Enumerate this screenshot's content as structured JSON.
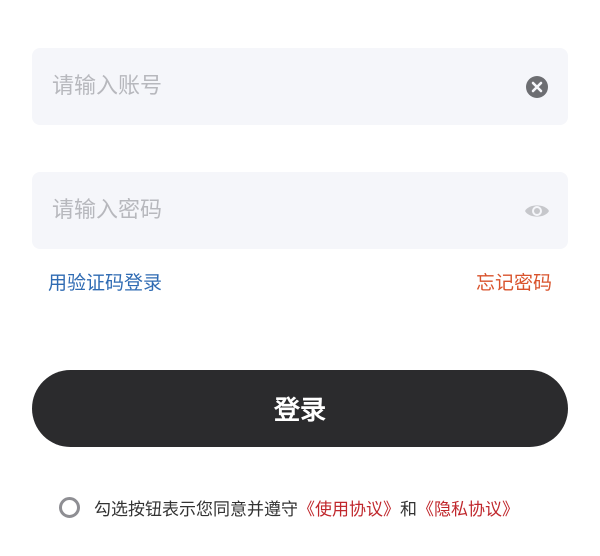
{
  "account": {
    "value": "",
    "placeholder": "请输入账号",
    "clear_icon": "clear-circle-icon"
  },
  "password": {
    "value": "",
    "placeholder": "请输入密码",
    "toggle_icon": "eye-icon"
  },
  "links": {
    "sms_login": "用验证码登录",
    "forgot_password": "忘记密码"
  },
  "login_button": "登录",
  "agreement": {
    "checked": false,
    "text": "勾选按钮表示您同意并遵守",
    "terms_link": "《使用协议》",
    "conjunction": "和",
    "privacy_link": "《隐私协议》"
  },
  "colors": {
    "field_bg": "#f5f6fa",
    "button_bg": "#2b2b2d",
    "link_blue": "#2f6bb3",
    "link_orange": "#d9532c",
    "link_red": "#c0282d"
  }
}
